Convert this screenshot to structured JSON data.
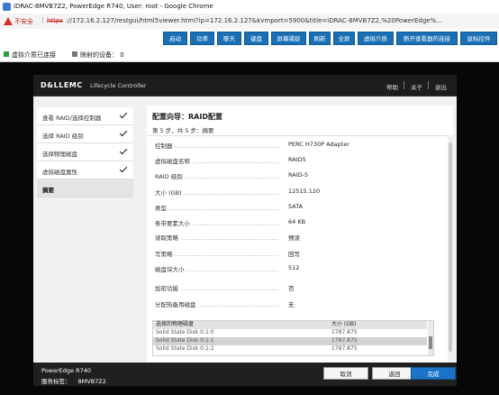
{
  "window": {
    "title": "iDRAC-8MVB7Z2, PowerEdge R740, User: root - Google Chrome"
  },
  "address": {
    "insecure_label": "不安全",
    "scheme": "https",
    "url": "://172.16.2.127/restgui/html5viewer.html?ip=172.16.2.127&kvmport=5900&title=iDRAC-8MVB7Z2,%20PowerEdge%..."
  },
  "viewer_toolbar": {
    "buttons": [
      "启动",
      "功率",
      "聊天",
      "键盘",
      "屏幕捕捉",
      "刷新",
      "全屏",
      "虚拟介质",
      "断开查看器的连接",
      "鼠标控件"
    ]
  },
  "viewer_status": {
    "vmedia": "虚拟介质已连接",
    "mapped": "映射的设备： 0",
    "colors": {
      "vmedia": "#2e9e3e",
      "mapped": "#777777"
    }
  },
  "lc_header": {
    "logo": "D&LLEMC",
    "product": "Lifecycle Controller",
    "links": [
      "帮助",
      "关于",
      "退出"
    ]
  },
  "sidebar": {
    "items": [
      {
        "label": "查看 RAID/选择控制器",
        "done": true
      },
      {
        "label": "选择 RAID 级别",
        "done": true
      },
      {
        "label": "选择物理磁盘",
        "done": true
      },
      {
        "label": "虚拟磁盘属性",
        "done": true
      },
      {
        "label": "摘要",
        "done": false,
        "active": true
      }
    ]
  },
  "main": {
    "title": "配置向导：RAID配置",
    "step": "第 5 步，共 5 步：摘要",
    "fields": [
      {
        "label": "控制器",
        "value": "PERC H730P Adapter"
      },
      {
        "label": "虚拟磁盘名称",
        "value": "RAID5"
      },
      {
        "label": "RAID 级别",
        "value": "RAID-5"
      },
      {
        "label": "大小 (GB)",
        "value": "12515.120"
      },
      {
        "label": "类型",
        "value": "SATA"
      },
      {
        "label": "条带要素大小",
        "value": "64 KB"
      },
      {
        "label": "读取策略",
        "value": "预读"
      },
      {
        "label": "写策略",
        "value": "回写"
      },
      {
        "label": "磁盘块大小",
        "value": "512"
      },
      {
        "label": "加密功能",
        "value": "否"
      },
      {
        "label": "分配热备用磁盘",
        "value": "无"
      }
    ],
    "disk_table": {
      "headers": [
        "选择的物理磁盘",
        "大小 (GB)"
      ],
      "rows": [
        [
          "Solid State Disk 0:1:0",
          "1787.875"
        ],
        [
          "Solid State Disk 0:1:1",
          "1787.875"
        ],
        [
          "Solid State Disk 0:1:2",
          "1787.875"
        ]
      ]
    }
  },
  "footer": {
    "model": "PowerEdge R740",
    "service_tag_label": "服务标签：",
    "service_tag": "8MVB7Z2",
    "buttons": {
      "cancel": "取消",
      "back": "返回",
      "finish": "完成"
    }
  }
}
